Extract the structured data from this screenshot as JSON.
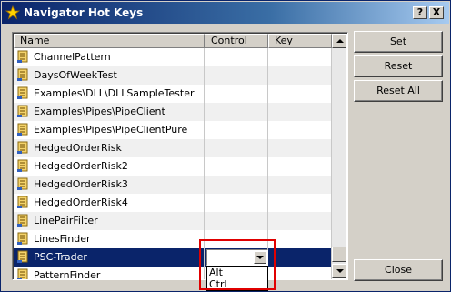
{
  "window": {
    "title": "Navigator Hot Keys",
    "help_label": "?",
    "close_label": "X"
  },
  "columns": {
    "name": "Name",
    "control": "Control",
    "key": "Key"
  },
  "rows": [
    {
      "name": "ChannelPattern",
      "control": "",
      "key": ""
    },
    {
      "name": "DaysOfWeekTest",
      "control": "",
      "key": ""
    },
    {
      "name": "Examples\\DLL\\DLLSampleTester",
      "control": "",
      "key": ""
    },
    {
      "name": "Examples\\Pipes\\PipeClient",
      "control": "",
      "key": ""
    },
    {
      "name": "Examples\\Pipes\\PipeClientPure",
      "control": "",
      "key": ""
    },
    {
      "name": "HedgedOrderRisk",
      "control": "",
      "key": ""
    },
    {
      "name": "HedgedOrderRisk2",
      "control": "",
      "key": ""
    },
    {
      "name": "HedgedOrderRisk3",
      "control": "",
      "key": ""
    },
    {
      "name": "HedgedOrderRisk4",
      "control": "",
      "key": ""
    },
    {
      "name": "LinePairFilter",
      "control": "",
      "key": ""
    },
    {
      "name": "LinesFinder",
      "control": "",
      "key": ""
    },
    {
      "name": "PSC-Trader",
      "control": "",
      "key": "",
      "selected": true
    },
    {
      "name": "PatternFinder",
      "control": "",
      "key": ""
    }
  ],
  "control_combo": {
    "value": "",
    "options": [
      "Alt",
      "Ctrl"
    ]
  },
  "buttons": {
    "set": "Set",
    "reset": "Reset",
    "reset_all": "Reset All",
    "close": "Close"
  },
  "colors": {
    "selection": "#0a246a",
    "highlight_box": "#e00000",
    "title_gradient_start": "#0a246a"
  }
}
